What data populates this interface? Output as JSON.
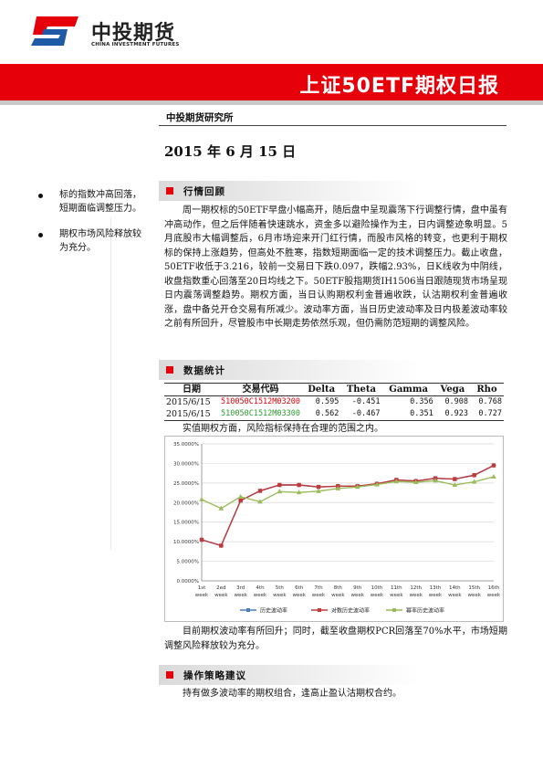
{
  "header": {
    "company_cn": "中投期货",
    "company_en": "CHINA INVESTMENT FUTURES",
    "report_title": "上证50ETF期权日报",
    "institute": "中投期货研究所",
    "date": "2015 年 6 月 15 日",
    "colors": {
      "brand_red": "#e5000a",
      "brand_blue": "#1f5aa6"
    }
  },
  "sidebar": {
    "points": [
      "标的指数冲高回落，短期面临调整压力。",
      "期权市场风险释放较为充分。"
    ]
  },
  "sections": {
    "market_review": {
      "title": "行情回顾",
      "text": "周一期权标的50ETF早盘小幅高开，随后盘中呈现震荡下行调整行情，盘中虽有冲高动作，但之后伴随着快速跳水，资金多以避险操作为主，日内调整迹象明显。5月底股市大幅调整后，6月市场迎来开门红行情，而股市风格的转变，也更利于期权标的保持上涨趋势，但高处不胜寒，指数短期面临一定的技术调整压力。截止收盘，50ETF收低于3.216，较前一交易日下跌0.097，跌幅2.93%，日K线收为中阴线，收盘指数重心回落至20日均线之下。50ETF股指期货IH1506当日跟随现货市场呈现日内震荡调整趋势。期权方面，当日认购期权利金普遍收跌，认沽期权利金普遍收涨，盘中备兑开仓交易有所减少。波动率方面，当日历史波动率及日内极差波动率较之前有所回升，尽管股市中长期走势依然乐观，但仍需防范短期的调整风险。"
    },
    "data_stats": {
      "title": "数据统计",
      "table": {
        "headers": [
          "日期",
          "交易代码",
          "Delta",
          "Theta",
          "Gamma",
          "Vega",
          "Rho"
        ],
        "rows": [
          {
            "date": "2015/6/15",
            "code": "510050C1512M03200",
            "delta": "0.595",
            "theta": "-0.451",
            "gamma": "0.356",
            "vega": "0.908",
            "rho": "0.768",
            "code_color": "#e5000a"
          },
          {
            "date": "2015/6/15",
            "code": "510050C1512M03300",
            "delta": "0.562",
            "theta": "-0.467",
            "gamma": "0.351",
            "vega": "0.923",
            "rho": "0.727",
            "code_color": "#2e9d2e"
          }
        ]
      },
      "note": "实值期权方面，风险指标保持在合理的范围之内。",
      "after_chart": "目前期权波动率有所回升；同时，截至收盘期权PCR回落至70%水平，市场短期调整风险释放较为充分。"
    },
    "strategy": {
      "title": "操作策略建议",
      "text": "持有做多波动率的期权组合，逢高止盈认沽期权合约。"
    }
  },
  "chart_data": {
    "type": "line",
    "categories": [
      "1st week",
      "2ed week",
      "3rd week",
      "4th week",
      "5th week",
      "6th week",
      "7th week",
      "8th week",
      "9th week",
      "10th week",
      "11th week",
      "12th week",
      "13th week",
      "14th week",
      "15th week",
      "16th week"
    ],
    "y_tick_labels": [
      "0.0000%",
      "5.0000%",
      "10.0000%",
      "15.0000%",
      "20.0000%",
      "25.0000%",
      "30.0000%",
      "35.0000%"
    ],
    "ylim": [
      0,
      35
    ],
    "grid": true,
    "legend_position": "bottom",
    "series": [
      {
        "name": "历史波动率",
        "color": "#4a7ebb",
        "marker": "diamond",
        "values": [
          10.5,
          9.0,
          20.5,
          23.0,
          24.5,
          24.5,
          24.0,
          24.2,
          24.2,
          24.8,
          25.8,
          25.5,
          26.2,
          26.0,
          27.0,
          29.5
        ]
      },
      {
        "name": "对数历史波动率",
        "color": "#c0393b",
        "marker": "square",
        "values": [
          10.5,
          9.0,
          20.5,
          23.0,
          24.5,
          24.5,
          24.0,
          24.2,
          24.2,
          24.8,
          25.8,
          25.5,
          26.2,
          26.0,
          27.0,
          29.5
        ]
      },
      {
        "name": "幂率历史波动率",
        "color": "#9bbb59",
        "marker": "triangle",
        "values": [
          20.8,
          18.5,
          21.5,
          20.2,
          22.8,
          22.6,
          22.9,
          23.6,
          24.0,
          24.6,
          25.4,
          25.2,
          25.6,
          24.5,
          25.3,
          26.6
        ]
      }
    ]
  }
}
